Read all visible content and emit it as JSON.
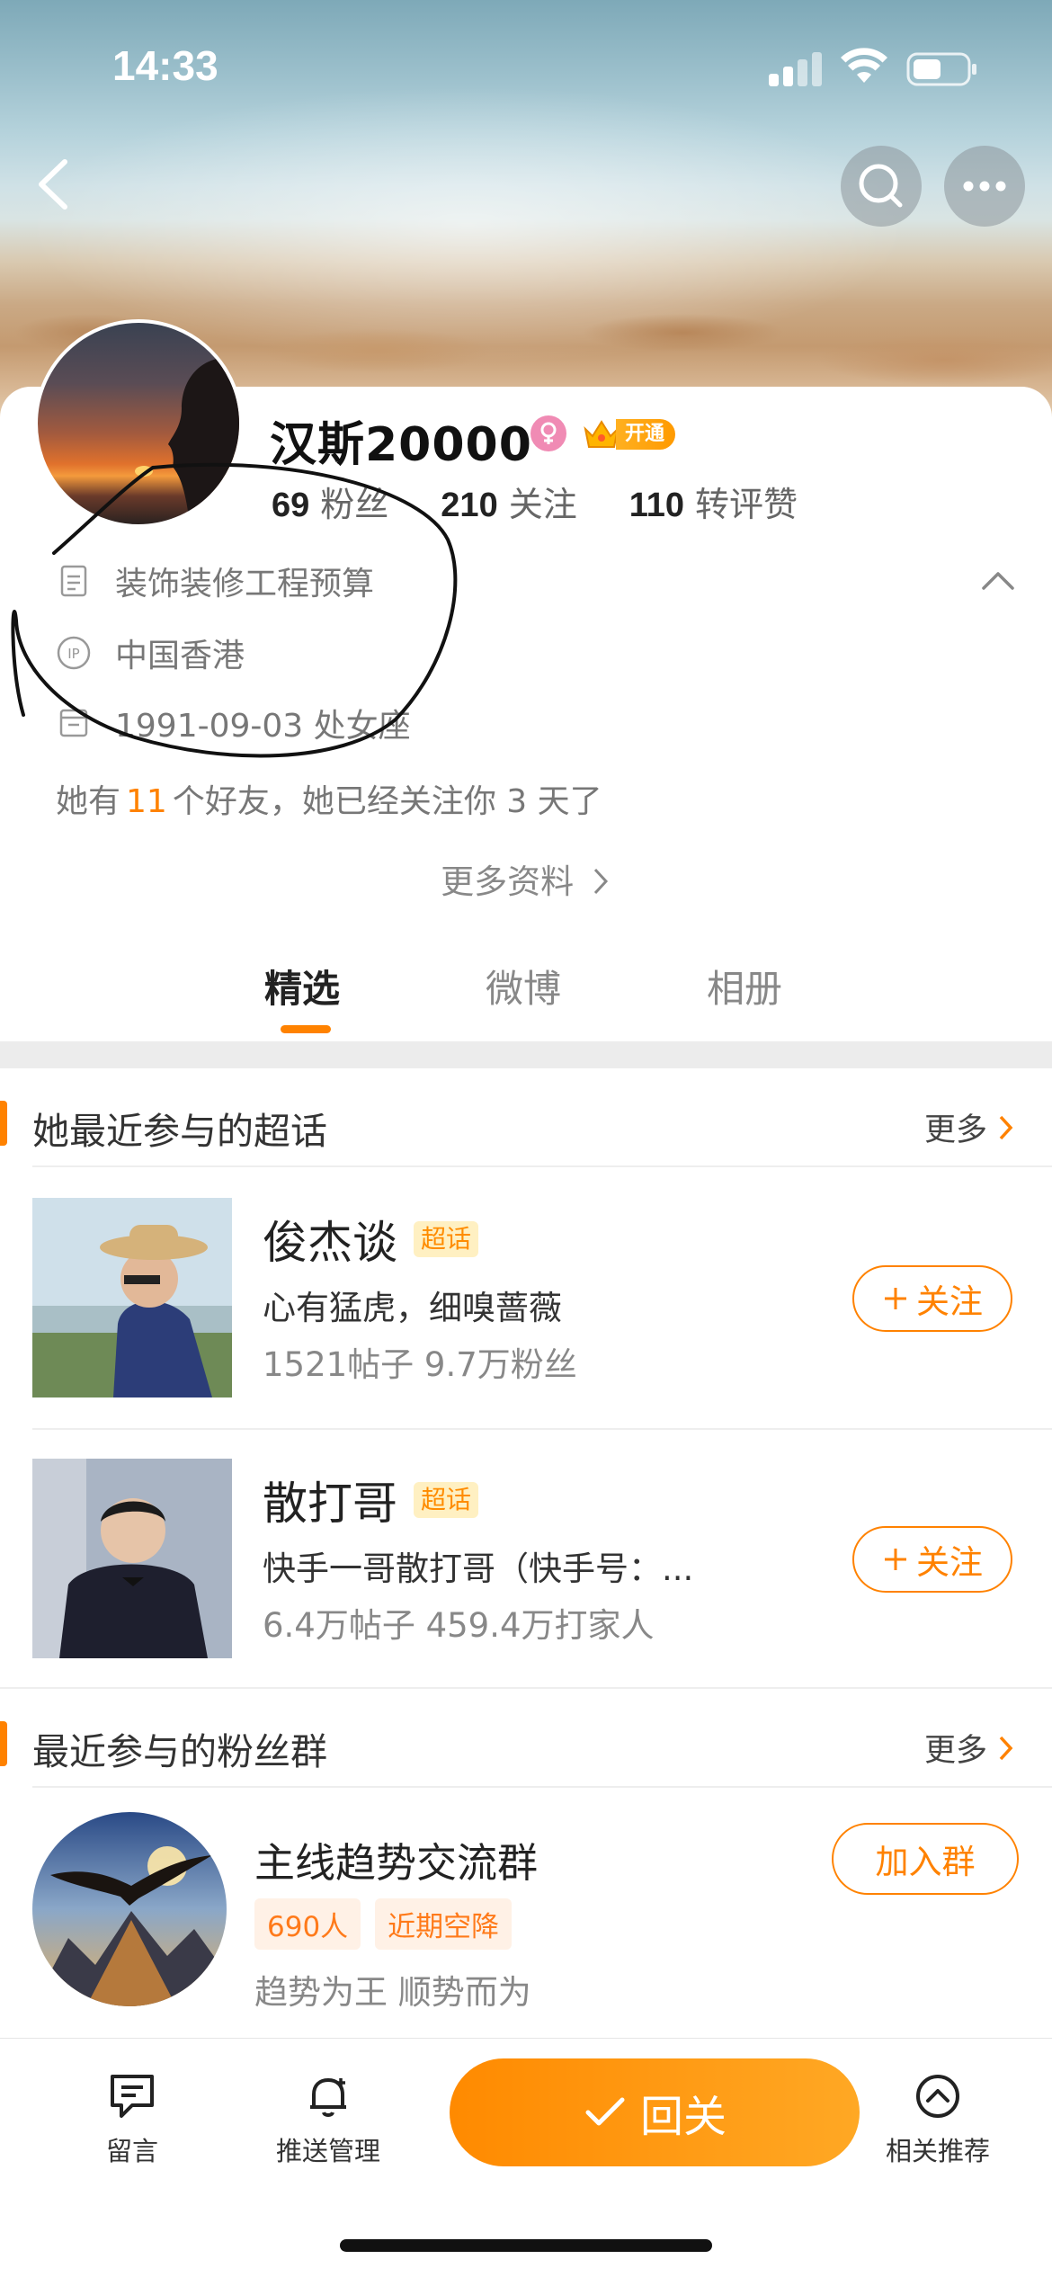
{
  "status_bar": {
    "time": "14:33"
  },
  "header": {
    "back_icon": "chevron-left-icon",
    "search_icon": "search-icon",
    "more_icon": "ellipsis-icon"
  },
  "profile": {
    "username": "汉斯20000",
    "vip_label": "开通",
    "stats": [
      {
        "value": "69",
        "label": "粉丝"
      },
      {
        "value": "210",
        "label": "关注"
      },
      {
        "value": "110",
        "label": "转评赞"
      }
    ],
    "info": {
      "bio": "装饰装修工程预算",
      "ip": "中国香港",
      "birthday": "1991-09-03 处女座"
    },
    "friends": {
      "prefix": "她有",
      "count": "11",
      "suffix": "个好友，她已经关注你 3 天了"
    },
    "more_info": "更多资料"
  },
  "tabs": [
    {
      "label": "精选",
      "active": true
    },
    {
      "label": "微博",
      "active": false
    },
    {
      "label": "相册",
      "active": false
    }
  ],
  "topics_section": {
    "title": "她最近参与的超话",
    "more": "更多",
    "items": [
      {
        "name": "俊杰谈",
        "badge": "超话",
        "desc": "心有猛虎，细嗅蔷薇",
        "meta": "1521帖子 9.7万粉丝",
        "follow": "关注"
      },
      {
        "name": "散打哥",
        "badge": "超话",
        "desc": "快手一哥散打哥（快手号：...",
        "meta": "6.4万帖子 459.4万打家人",
        "follow": "关注"
      }
    ]
  },
  "groups_section": {
    "title": "最近参与的粉丝群",
    "more": "更多",
    "item": {
      "name": "主线趋势交流群",
      "tags": [
        "690人",
        "近期空降"
      ],
      "desc": "趋势为王 顺势而为",
      "join": "加入群"
    }
  },
  "bottom_bar": {
    "message": "留言",
    "push": "推送管理",
    "follow_back": "回关",
    "related": "相关推荐"
  },
  "colors": {
    "accent": "#ff8200",
    "badge_bg": "#fff0c2"
  }
}
